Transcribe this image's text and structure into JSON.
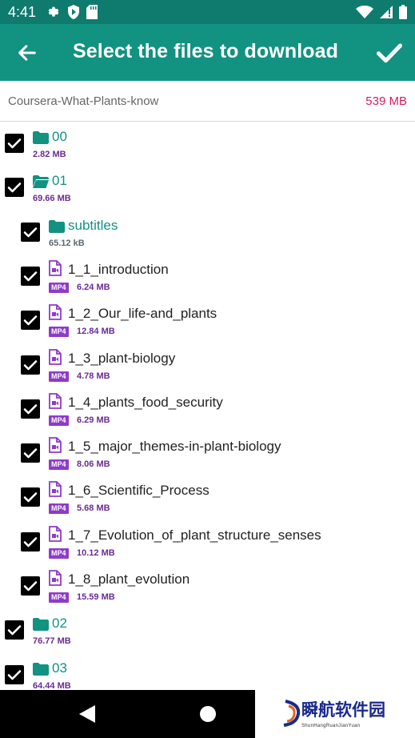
{
  "status": {
    "time": "4:41"
  },
  "appbar": {
    "title": "Select the files to download"
  },
  "course": {
    "name": "Coursera-What-Plants-know",
    "size": "539 MB"
  },
  "items": [
    {
      "type": "folder",
      "name": "00",
      "size": "2.82 MB",
      "level": 0,
      "open": false,
      "checked": true
    },
    {
      "type": "folder",
      "name": "01",
      "size": "69.66 MB",
      "level": 0,
      "open": true,
      "checked": true
    },
    {
      "type": "folder",
      "name": "subtitles",
      "size": "65.12 kB",
      "level": 1,
      "open": false,
      "checked": true
    },
    {
      "type": "file",
      "name": "1_1_introduction",
      "badge": "MP4",
      "size": "6.24 MB",
      "level": 1,
      "checked": true
    },
    {
      "type": "file",
      "name": "1_2_Our_life-and_plants",
      "badge": "MP4",
      "size": "12.84 MB",
      "level": 1,
      "checked": true
    },
    {
      "type": "file",
      "name": "1_3_plant-biology",
      "badge": "MP4",
      "size": "4.78 MB",
      "level": 1,
      "checked": true
    },
    {
      "type": "file",
      "name": "1_4_plants_food_security",
      "badge": "MP4",
      "size": "6.29 MB",
      "level": 1,
      "checked": true
    },
    {
      "type": "file",
      "name": "1_5_major_themes-in-plant-biology",
      "badge": "MP4",
      "size": "8.06 MB",
      "level": 1,
      "checked": true
    },
    {
      "type": "file",
      "name": "1_6_Scientific_Process",
      "badge": "MP4",
      "size": "5.68 MB",
      "level": 1,
      "checked": true
    },
    {
      "type": "file",
      "name": "1_7_Evolution_of_plant_structure_senses",
      "badge": "MP4",
      "size": "10.12 MB",
      "level": 1,
      "checked": true
    },
    {
      "type": "file",
      "name": "1_8_plant_evolution",
      "badge": "MP4",
      "size": "15.59 MB",
      "level": 1,
      "checked": true
    },
    {
      "type": "folder",
      "name": "02",
      "size": "76.77 MB",
      "level": 0,
      "open": false,
      "checked": true
    },
    {
      "type": "folder",
      "name": "03",
      "size": "64.44 MB",
      "level": 0,
      "open": false,
      "checked": true
    }
  ],
  "watermark": {
    "text": "瞬航软件园",
    "sub": "ShunHangRuanJianYuan"
  },
  "colors": {
    "accent": "#129281",
    "status_bar": "#0f7a6e",
    "size_text": "#d81b60",
    "badge": "#8e3bc7"
  }
}
